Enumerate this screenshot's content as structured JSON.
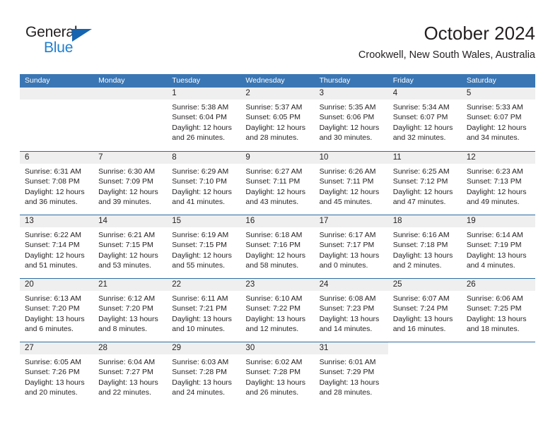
{
  "branding": {
    "logo_primary": "General",
    "logo_secondary": "Blue",
    "triangle_color": "#1665b0",
    "secondary_color": "#1f7fd0"
  },
  "header": {
    "title": "October 2024",
    "subtitle": "Crookwell, New South Wales, Australia"
  },
  "theme": {
    "header_blue": "#3a76b4",
    "row_border_blue": "#2e6da4",
    "daynum_gray": "#efefef",
    "text": "#231f20"
  },
  "weekdays": [
    "Sunday",
    "Monday",
    "Tuesday",
    "Wednesday",
    "Thursday",
    "Friday",
    "Saturday"
  ],
  "weeks": [
    [
      {
        "day": "",
        "sunrise": "",
        "sunset": "",
        "daylight_a": "",
        "daylight_b": "",
        "empty": true
      },
      {
        "day": "",
        "sunrise": "",
        "sunset": "",
        "daylight_a": "",
        "daylight_b": "",
        "empty": true
      },
      {
        "day": "1",
        "sunrise": "Sunrise: 5:38 AM",
        "sunset": "Sunset: 6:04 PM",
        "daylight_a": "Daylight: 12 hours",
        "daylight_b": "and 26 minutes."
      },
      {
        "day": "2",
        "sunrise": "Sunrise: 5:37 AM",
        "sunset": "Sunset: 6:05 PM",
        "daylight_a": "Daylight: 12 hours",
        "daylight_b": "and 28 minutes."
      },
      {
        "day": "3",
        "sunrise": "Sunrise: 5:35 AM",
        "sunset": "Sunset: 6:06 PM",
        "daylight_a": "Daylight: 12 hours",
        "daylight_b": "and 30 minutes."
      },
      {
        "day": "4",
        "sunrise": "Sunrise: 5:34 AM",
        "sunset": "Sunset: 6:07 PM",
        "daylight_a": "Daylight: 12 hours",
        "daylight_b": "and 32 minutes."
      },
      {
        "day": "5",
        "sunrise": "Sunrise: 5:33 AM",
        "sunset": "Sunset: 6:07 PM",
        "daylight_a": "Daylight: 12 hours",
        "daylight_b": "and 34 minutes."
      }
    ],
    [
      {
        "day": "6",
        "sunrise": "Sunrise: 6:31 AM",
        "sunset": "Sunset: 7:08 PM",
        "daylight_a": "Daylight: 12 hours",
        "daylight_b": "and 36 minutes."
      },
      {
        "day": "7",
        "sunrise": "Sunrise: 6:30 AM",
        "sunset": "Sunset: 7:09 PM",
        "daylight_a": "Daylight: 12 hours",
        "daylight_b": "and 39 minutes."
      },
      {
        "day": "8",
        "sunrise": "Sunrise: 6:29 AM",
        "sunset": "Sunset: 7:10 PM",
        "daylight_a": "Daylight: 12 hours",
        "daylight_b": "and 41 minutes."
      },
      {
        "day": "9",
        "sunrise": "Sunrise: 6:27 AM",
        "sunset": "Sunset: 7:11 PM",
        "daylight_a": "Daylight: 12 hours",
        "daylight_b": "and 43 minutes."
      },
      {
        "day": "10",
        "sunrise": "Sunrise: 6:26 AM",
        "sunset": "Sunset: 7:11 PM",
        "daylight_a": "Daylight: 12 hours",
        "daylight_b": "and 45 minutes."
      },
      {
        "day": "11",
        "sunrise": "Sunrise: 6:25 AM",
        "sunset": "Sunset: 7:12 PM",
        "daylight_a": "Daylight: 12 hours",
        "daylight_b": "and 47 minutes."
      },
      {
        "day": "12",
        "sunrise": "Sunrise: 6:23 AM",
        "sunset": "Sunset: 7:13 PM",
        "daylight_a": "Daylight: 12 hours",
        "daylight_b": "and 49 minutes."
      }
    ],
    [
      {
        "day": "13",
        "sunrise": "Sunrise: 6:22 AM",
        "sunset": "Sunset: 7:14 PM",
        "daylight_a": "Daylight: 12 hours",
        "daylight_b": "and 51 minutes."
      },
      {
        "day": "14",
        "sunrise": "Sunrise: 6:21 AM",
        "sunset": "Sunset: 7:15 PM",
        "daylight_a": "Daylight: 12 hours",
        "daylight_b": "and 53 minutes."
      },
      {
        "day": "15",
        "sunrise": "Sunrise: 6:19 AM",
        "sunset": "Sunset: 7:15 PM",
        "daylight_a": "Daylight: 12 hours",
        "daylight_b": "and 55 minutes."
      },
      {
        "day": "16",
        "sunrise": "Sunrise: 6:18 AM",
        "sunset": "Sunset: 7:16 PM",
        "daylight_a": "Daylight: 12 hours",
        "daylight_b": "and 58 minutes."
      },
      {
        "day": "17",
        "sunrise": "Sunrise: 6:17 AM",
        "sunset": "Sunset: 7:17 PM",
        "daylight_a": "Daylight: 13 hours",
        "daylight_b": "and 0 minutes."
      },
      {
        "day": "18",
        "sunrise": "Sunrise: 6:16 AM",
        "sunset": "Sunset: 7:18 PM",
        "daylight_a": "Daylight: 13 hours",
        "daylight_b": "and 2 minutes."
      },
      {
        "day": "19",
        "sunrise": "Sunrise: 6:14 AM",
        "sunset": "Sunset: 7:19 PM",
        "daylight_a": "Daylight: 13 hours",
        "daylight_b": "and 4 minutes."
      }
    ],
    [
      {
        "day": "20",
        "sunrise": "Sunrise: 6:13 AM",
        "sunset": "Sunset: 7:20 PM",
        "daylight_a": "Daylight: 13 hours",
        "daylight_b": "and 6 minutes."
      },
      {
        "day": "21",
        "sunrise": "Sunrise: 6:12 AM",
        "sunset": "Sunset: 7:20 PM",
        "daylight_a": "Daylight: 13 hours",
        "daylight_b": "and 8 minutes."
      },
      {
        "day": "22",
        "sunrise": "Sunrise: 6:11 AM",
        "sunset": "Sunset: 7:21 PM",
        "daylight_a": "Daylight: 13 hours",
        "daylight_b": "and 10 minutes."
      },
      {
        "day": "23",
        "sunrise": "Sunrise: 6:10 AM",
        "sunset": "Sunset: 7:22 PM",
        "daylight_a": "Daylight: 13 hours",
        "daylight_b": "and 12 minutes."
      },
      {
        "day": "24",
        "sunrise": "Sunrise: 6:08 AM",
        "sunset": "Sunset: 7:23 PM",
        "daylight_a": "Daylight: 13 hours",
        "daylight_b": "and 14 minutes."
      },
      {
        "day": "25",
        "sunrise": "Sunrise: 6:07 AM",
        "sunset": "Sunset: 7:24 PM",
        "daylight_a": "Daylight: 13 hours",
        "daylight_b": "and 16 minutes."
      },
      {
        "day": "26",
        "sunrise": "Sunrise: 6:06 AM",
        "sunset": "Sunset: 7:25 PM",
        "daylight_a": "Daylight: 13 hours",
        "daylight_b": "and 18 minutes."
      }
    ],
    [
      {
        "day": "27",
        "sunrise": "Sunrise: 6:05 AM",
        "sunset": "Sunset: 7:26 PM",
        "daylight_a": "Daylight: 13 hours",
        "daylight_b": "and 20 minutes."
      },
      {
        "day": "28",
        "sunrise": "Sunrise: 6:04 AM",
        "sunset": "Sunset: 7:27 PM",
        "daylight_a": "Daylight: 13 hours",
        "daylight_b": "and 22 minutes."
      },
      {
        "day": "29",
        "sunrise": "Sunrise: 6:03 AM",
        "sunset": "Sunset: 7:28 PM",
        "daylight_a": "Daylight: 13 hours",
        "daylight_b": "and 24 minutes."
      },
      {
        "day": "30",
        "sunrise": "Sunrise: 6:02 AM",
        "sunset": "Sunset: 7:28 PM",
        "daylight_a": "Daylight: 13 hours",
        "daylight_b": "and 26 minutes."
      },
      {
        "day": "31",
        "sunrise": "Sunrise: 6:01 AM",
        "sunset": "Sunset: 7:29 PM",
        "daylight_a": "Daylight: 13 hours",
        "daylight_b": "and 28 minutes."
      },
      {
        "day": "",
        "sunrise": "",
        "sunset": "",
        "daylight_a": "",
        "daylight_b": "",
        "blank": true
      },
      {
        "day": "",
        "sunrise": "",
        "sunset": "",
        "daylight_a": "",
        "daylight_b": "",
        "blank": true
      }
    ]
  ]
}
